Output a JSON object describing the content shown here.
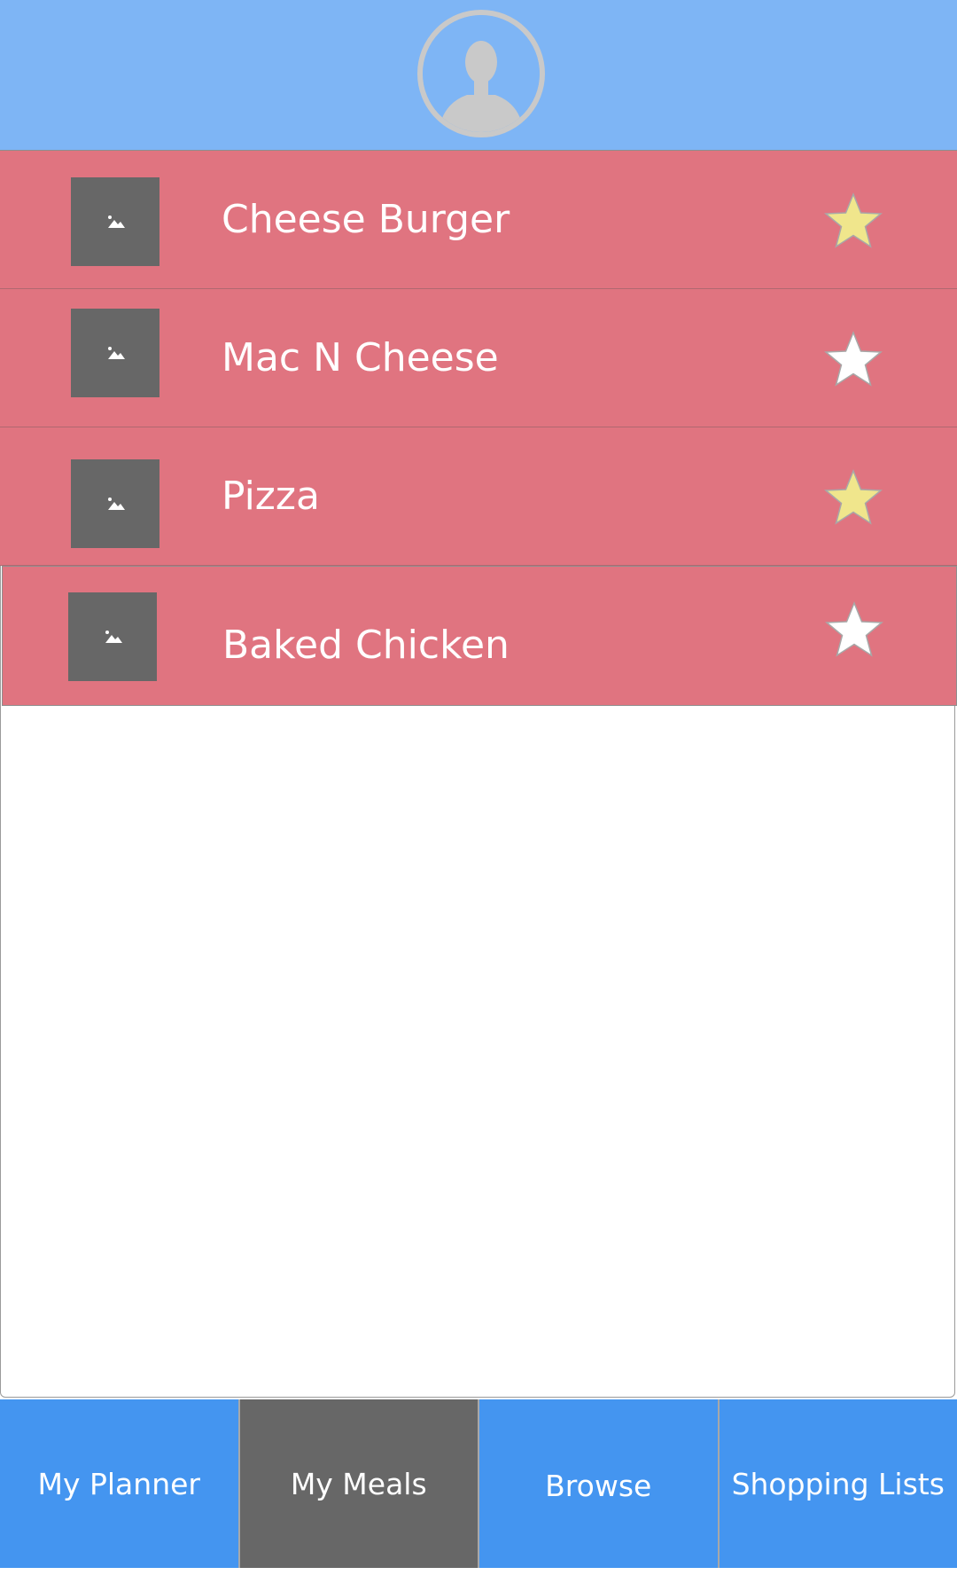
{
  "header": {
    "avatar_icon": "user-avatar-icon"
  },
  "meals": [
    {
      "name": "Cheese Burger",
      "favorite": true,
      "thumb_icon": "image-placeholder-icon"
    },
    {
      "name": "Mac N Cheese",
      "favorite": false,
      "thumb_icon": "image-placeholder-icon"
    },
    {
      "name": "Pizza",
      "favorite": true,
      "thumb_icon": "image-placeholder-icon"
    },
    {
      "name": "Baked Chicken",
      "favorite": false,
      "thumb_icon": "image-placeholder-icon"
    }
  ],
  "tabs": [
    {
      "label": "My Planner",
      "active": false
    },
    {
      "label": "My Meals",
      "active": true
    },
    {
      "label": "Browse",
      "active": false
    },
    {
      "label": "Shopping Lists",
      "active": false
    }
  ],
  "colors": {
    "header_bg": "#7eb5f5",
    "row_bg": "#e07480",
    "tab_bg": "#4495f0",
    "tab_active_bg": "#676767",
    "star_favorite": "#f0e68c",
    "star_default": "#ffffff"
  }
}
